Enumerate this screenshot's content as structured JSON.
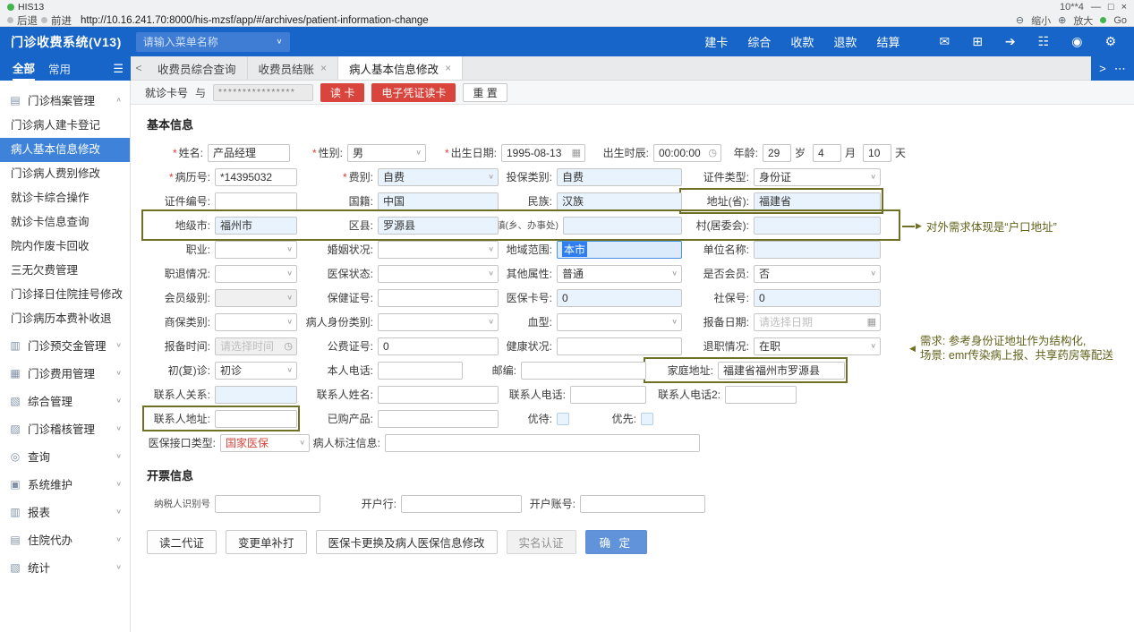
{
  "icons": {
    "chevron_down": "∨",
    "chevron_up": "∧",
    "close": "×",
    "menu": "☰",
    "arrow_right": "▶",
    "arrow_left": "◀",
    "calendar": "▦",
    "clock": "◷",
    "zoom_out": "⊖",
    "zoom_in": "⊕"
  },
  "colors": {
    "header_blue": "#1765c8",
    "active_item_blue": "#3e82da",
    "danger_red": "#d9453c",
    "annotation_olive": "#6f6f25",
    "primary_button_blue": "#6193da",
    "highlight_input": "#e9f3fd"
  },
  "browser": {
    "window_title": "HIS13",
    "window_note": "10**4",
    "win_minimize": "—",
    "win_maximize": "□",
    "win_close": "×",
    "back_label": "后退",
    "forward_label": "前进",
    "url": "http://10.16.241.70:8000/his-mzsf/app/#/archives/patient-information-change",
    "zoom_out_label": "缩小",
    "zoom_in_label": "放大",
    "go_label": "Go"
  },
  "header": {
    "title": "门诊收费系统(V13)",
    "search_placeholder": "请输入菜单名称",
    "actions": [
      "建卡",
      "综合",
      "收款",
      "退款",
      "结算"
    ],
    "icons": [
      {
        "name": "voucher-icon",
        "glyph": "✉"
      },
      {
        "name": "cashier-icon",
        "glyph": "⊞"
      },
      {
        "name": "send-icon",
        "glyph": "➔"
      },
      {
        "name": "printer-icon",
        "glyph": "☷"
      },
      {
        "name": "view-icon",
        "glyph": "◉"
      },
      {
        "name": "settings-icon",
        "glyph": "⚙"
      }
    ]
  },
  "nav": {
    "filters": [
      {
        "label": "全部",
        "active": true
      },
      {
        "label": "常用",
        "active": false
      }
    ],
    "scroll_left": "<",
    "scroll_right": ">",
    "more": "⋯",
    "tabs": [
      {
        "label": "收费员综合查询",
        "closable": false,
        "active": false
      },
      {
        "label": "收费员结账",
        "closable": true,
        "active": false
      },
      {
        "label": "病人基本信息修改",
        "closable": true,
        "active": true
      }
    ]
  },
  "sidebar": {
    "sections": [
      {
        "icon": "archive-folder-icon",
        "glyph": "▤",
        "label": "门诊档案管理",
        "expanded": true,
        "items": [
          {
            "label": "门诊病人建卡登记"
          },
          {
            "label": "病人基本信息修改",
            "active": true
          },
          {
            "label": "门诊病人费别修改"
          },
          {
            "label": "就诊卡综合操作"
          },
          {
            "label": "就诊卡信息查询"
          },
          {
            "label": "院内作废卡回收"
          },
          {
            "label": "三无欠费管理"
          },
          {
            "label": "门诊择日住院挂号修改"
          },
          {
            "label": "门诊病历本费补收退"
          }
        ]
      },
      {
        "icon": "prepay-icon",
        "glyph": "▥",
        "label": "门诊预交金管理"
      },
      {
        "icon": "fee-icon",
        "glyph": "▦",
        "label": "门诊费用管理"
      },
      {
        "icon": "composite-icon",
        "glyph": "▧",
        "label": "综合管理"
      },
      {
        "icon": "audit-icon",
        "glyph": "▨",
        "label": "门诊稽核管理"
      },
      {
        "icon": "query-icon",
        "glyph": "◎",
        "label": "查询"
      },
      {
        "icon": "system-icon",
        "glyph": "▣",
        "label": "系统维护"
      },
      {
        "icon": "report-icon",
        "glyph": "▥",
        "label": "报表"
      },
      {
        "icon": "inpatient-icon",
        "glyph": "▤",
        "label": "住院代办"
      },
      {
        "icon": "stats-icon",
        "glyph": "▧",
        "label": "统计"
      }
    ]
  },
  "card_bar": {
    "label": "就诊卡号",
    "toggle_icon": "与",
    "card_value": "****************",
    "read_button": "读 卡",
    "ecert_button": "电子凭证读卡",
    "reset_button": "重 置"
  },
  "form": {
    "basic_title": "基本信息",
    "invoice_title": "开票信息",
    "rows": [
      {
        "fields": [
          {
            "name": "patient-name",
            "label": "姓名:",
            "required": true,
            "type": "input",
            "value": "产品经理",
            "lw": 70,
            "cw": 92
          },
          {
            "name": "gender",
            "label": "性别:",
            "required": true,
            "type": "select",
            "value": "男",
            "lw": 64,
            "cw": 88
          },
          {
            "name": "birth-date",
            "label": "出生日期:",
            "required": true,
            "type": "date",
            "value": "1995-08-13",
            "lw": 84,
            "cw": 94
          },
          {
            "name": "birth-time",
            "label": "出生时辰:",
            "type": "time",
            "value": "00:00:00",
            "lw": 76,
            "cw": 76
          },
          {
            "name": "age",
            "label": "年龄:",
            "type": "age",
            "lw": 46,
            "parts": [
              {
                "value": "29",
                "unit": "岁"
              },
              {
                "value": "4",
                "unit": "月"
              },
              {
                "value": "10",
                "unit": "天"
              }
            ]
          }
        ]
      },
      {
        "fields": [
          {
            "name": "medical-record-no",
            "label": "病历号:",
            "required": true,
            "type": "input",
            "value": "*14395032"
          },
          {
            "name": "fee-type",
            "label": "费别:",
            "required": true,
            "type": "select",
            "value": "自费",
            "highlight": true
          },
          {
            "name": "insured-category",
            "label": "投保类别:",
            "type": "input",
            "value": "自费",
            "highlight": true
          },
          {
            "name": "id-type",
            "label": "证件类型:",
            "type": "select",
            "value": "身份证"
          }
        ]
      },
      {
        "fields": [
          {
            "name": "id-number",
            "label": "证件编号:",
            "type": "input",
            "value": ""
          },
          {
            "name": "nationality",
            "label": "国籍:",
            "type": "input",
            "value": "中国",
            "highlight": true
          },
          {
            "name": "ethnicity",
            "label": "民族:",
            "type": "input",
            "value": "汉族",
            "highlight": true
          },
          {
            "name": "address-province",
            "label": "地址(省):",
            "type": "input",
            "value": "福建省",
            "highlight": true,
            "anno": true
          }
        ]
      },
      {
        "anno": true,
        "note": {
          "kind": "inline",
          "text": "对外需求体现是“户口地址”"
        },
        "fields": [
          {
            "name": "city",
            "label": "地级市:",
            "type": "input",
            "value": "福州市",
            "highlight": true
          },
          {
            "name": "county",
            "label": "区县:",
            "type": "input",
            "value": "罗源县",
            "highlight": true
          },
          {
            "name": "town",
            "label": "镇(乡、办事处)",
            "type": "input",
            "value": "",
            "highlight": true,
            "small": true,
            "lw": 72,
            "cw": 133
          },
          {
            "name": "village",
            "label": "村(居委会):",
            "type": "input",
            "value": "",
            "highlight": true
          }
        ]
      },
      {
        "fields": [
          {
            "name": "occupation",
            "label": "职业:",
            "type": "select",
            "value": ""
          },
          {
            "name": "marital-status",
            "label": "婚姻状况:",
            "type": "select",
            "value": ""
          },
          {
            "name": "region-scope",
            "label": "地域范围:",
            "type": "seltext",
            "value": "本市"
          },
          {
            "name": "employer",
            "label": "单位名称:",
            "type": "input",
            "value": "",
            "highlight": true
          }
        ]
      },
      {
        "fields": [
          {
            "name": "employment-status",
            "label": "职退情况:",
            "type": "select",
            "value": ""
          },
          {
            "name": "medins-status",
            "label": "医保状态:",
            "type": "select",
            "value": ""
          },
          {
            "name": "other-attribute",
            "label": "其他属性:",
            "type": "select",
            "value": "普通"
          },
          {
            "name": "is-member",
            "label": "是否会员:",
            "type": "select",
            "value": "否"
          }
        ]
      },
      {
        "fields": [
          {
            "name": "member-level",
            "label": "会员级别:",
            "type": "select",
            "value": "",
            "disabled": true
          },
          {
            "name": "healthcare-cert-no",
            "label": "保健证号:",
            "type": "input",
            "value": ""
          },
          {
            "name": "medins-card-no",
            "label": "医保卡号:",
            "type": "input",
            "value": "0",
            "highlight": true
          },
          {
            "name": "social-security-no",
            "label": "社保号:",
            "type": "input",
            "value": "0",
            "highlight": true
          }
        ]
      },
      {
        "fields": [
          {
            "name": "commercial-ins-type",
            "label": "商保类别:",
            "type": "select",
            "value": ""
          },
          {
            "name": "patient-identity",
            "label": "病人身份类别:",
            "type": "select",
            "value": ""
          },
          {
            "name": "blood-type",
            "label": "血型:",
            "type": "select",
            "value": ""
          },
          {
            "name": "report-date",
            "label": "报备日期:",
            "type": "date",
            "value": "",
            "placeholder": "请选择日期"
          }
        ]
      },
      {
        "fields": [
          {
            "name": "report-time",
            "label": "报备时间:",
            "type": "time",
            "value": "",
            "placeholder": "请选择时间",
            "disabled": true
          },
          {
            "name": "public-fee-no",
            "label": "公费证号:",
            "type": "input",
            "value": "0"
          },
          {
            "name": "health-condition",
            "label": "健康状况:",
            "type": "input",
            "value": ""
          },
          {
            "name": "retire-status",
            "label": "退职情况:",
            "type": "select",
            "value": "在职"
          }
        ]
      },
      {
        "note": {
          "kind": "block",
          "lines": [
            "需求: 参考身份证地址作为结构化,",
            "场景: emr传染病上报、共享药房等配送"
          ]
        },
        "fields": [
          {
            "name": "visit-type",
            "label": "初(复)诊:",
            "type": "select",
            "value": "初诊"
          },
          {
            "name": "personal-phone",
            "label": "本人电话:",
            "type": "input",
            "value": "",
            "cw": 95
          },
          {
            "name": "postal-code",
            "label": "邮编:",
            "type": "input",
            "value": ""
          },
          {
            "name": "home-address",
            "label": "家庭地址:",
            "type": "input",
            "value": "福建省福州市罗源县",
            "anno": true
          }
        ]
      },
      {
        "fields": [
          {
            "name": "contact-relation",
            "label": "联系人关系:",
            "type": "input",
            "value": "",
            "highlight": true
          },
          {
            "name": "contact-name",
            "label": "联系人姓名:",
            "type": "input",
            "value": ""
          },
          {
            "name": "contact-phone",
            "label": "联系人电话:",
            "type": "input",
            "value": "",
            "lw": 80,
            "cw": 85
          },
          {
            "name": "contact-phone2",
            "label": "联系人电话2:",
            "type": "input",
            "value": "",
            "lw": 88,
            "cw": 80
          }
        ]
      },
      {
        "fields": [
          {
            "name": "contact-address",
            "label": "联系人地址:",
            "type": "input",
            "value": "",
            "anno": true
          },
          {
            "name": "purchased-products",
            "label": "已购产品:",
            "type": "input",
            "value": ""
          },
          {
            "name": "preferential",
            "label": "优待:",
            "type": "checkbox",
            "checked": false
          },
          {
            "name": "priority",
            "label": "优先:",
            "type": "checkbox",
            "checked": false
          }
        ]
      },
      {
        "fields": [
          {
            "name": "medins-interface-type",
            "label": "医保接口类型:",
            "type": "select",
            "value": "国家医保",
            "red": true,
            "lw": 84,
            "cw": 100
          },
          {
            "name": "patient-note",
            "label": "病人标注信息:",
            "type": "input",
            "value": "",
            "lw": 84,
            "cw": 352
          }
        ]
      }
    ],
    "invoice_row": [
      {
        "name": "taxpayer-id",
        "label": "纳税人识别号",
        "type": "input",
        "value": "",
        "small": true,
        "cw": 118
      },
      {
        "name": "bank-name",
        "label": "开户行:",
        "type": "input",
        "value": ""
      },
      {
        "name": "bank-account",
        "label": "开户账号:",
        "type": "input",
        "value": ""
      }
    ],
    "footer_buttons": [
      {
        "label": "读二代证",
        "style": "plain"
      },
      {
        "label": "变更单补打",
        "style": "plain"
      },
      {
        "label": "医保卡更换及病人医保信息修改",
        "style": "plain"
      },
      {
        "label": "实名认证",
        "style": "muted"
      },
      {
        "label": "确 定",
        "style": "primary"
      }
    ]
  }
}
